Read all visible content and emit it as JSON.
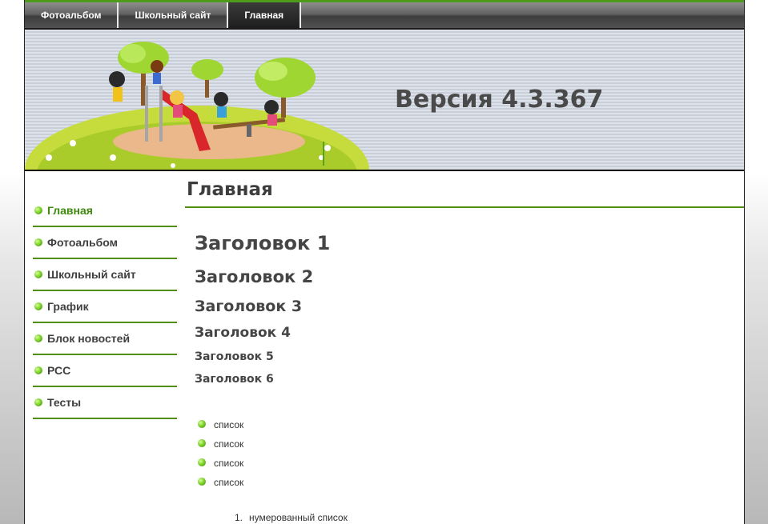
{
  "topnav": {
    "tabs": [
      {
        "label": "Фотоальбом",
        "active": false
      },
      {
        "label": "Школьный сайт",
        "active": false
      },
      {
        "label": "Главная",
        "active": true
      }
    ]
  },
  "header": {
    "version_text": "Версия 4.3.367",
    "illustration": "playground-children-illustration"
  },
  "sidebar": {
    "items": [
      {
        "label": "Главная",
        "active": true
      },
      {
        "label": "Фотоальбом",
        "active": false
      },
      {
        "label": "Школьный сайт",
        "active": false
      },
      {
        "label": "График",
        "active": false
      },
      {
        "label": "Блок новостей",
        "active": false
      },
      {
        "label": "РСС",
        "active": false
      },
      {
        "label": "Тесты",
        "active": false
      }
    ]
  },
  "main": {
    "page_title": "Главная",
    "headings": [
      "Заголовок 1",
      "Заголовок 2",
      "Заголовок 3",
      "Заголовок 4",
      "Заголовок 5",
      "Заголовок 6"
    ],
    "bullet_list": [
      "список",
      "список",
      "список",
      "список"
    ],
    "numbered_list": [
      {
        "number": "1.",
        "text": "нумерованный список"
      }
    ]
  },
  "colors": {
    "accent_green": "#4e8f10",
    "active_link": "#3d8a0c",
    "nav_dark": "#3d3d3d"
  }
}
